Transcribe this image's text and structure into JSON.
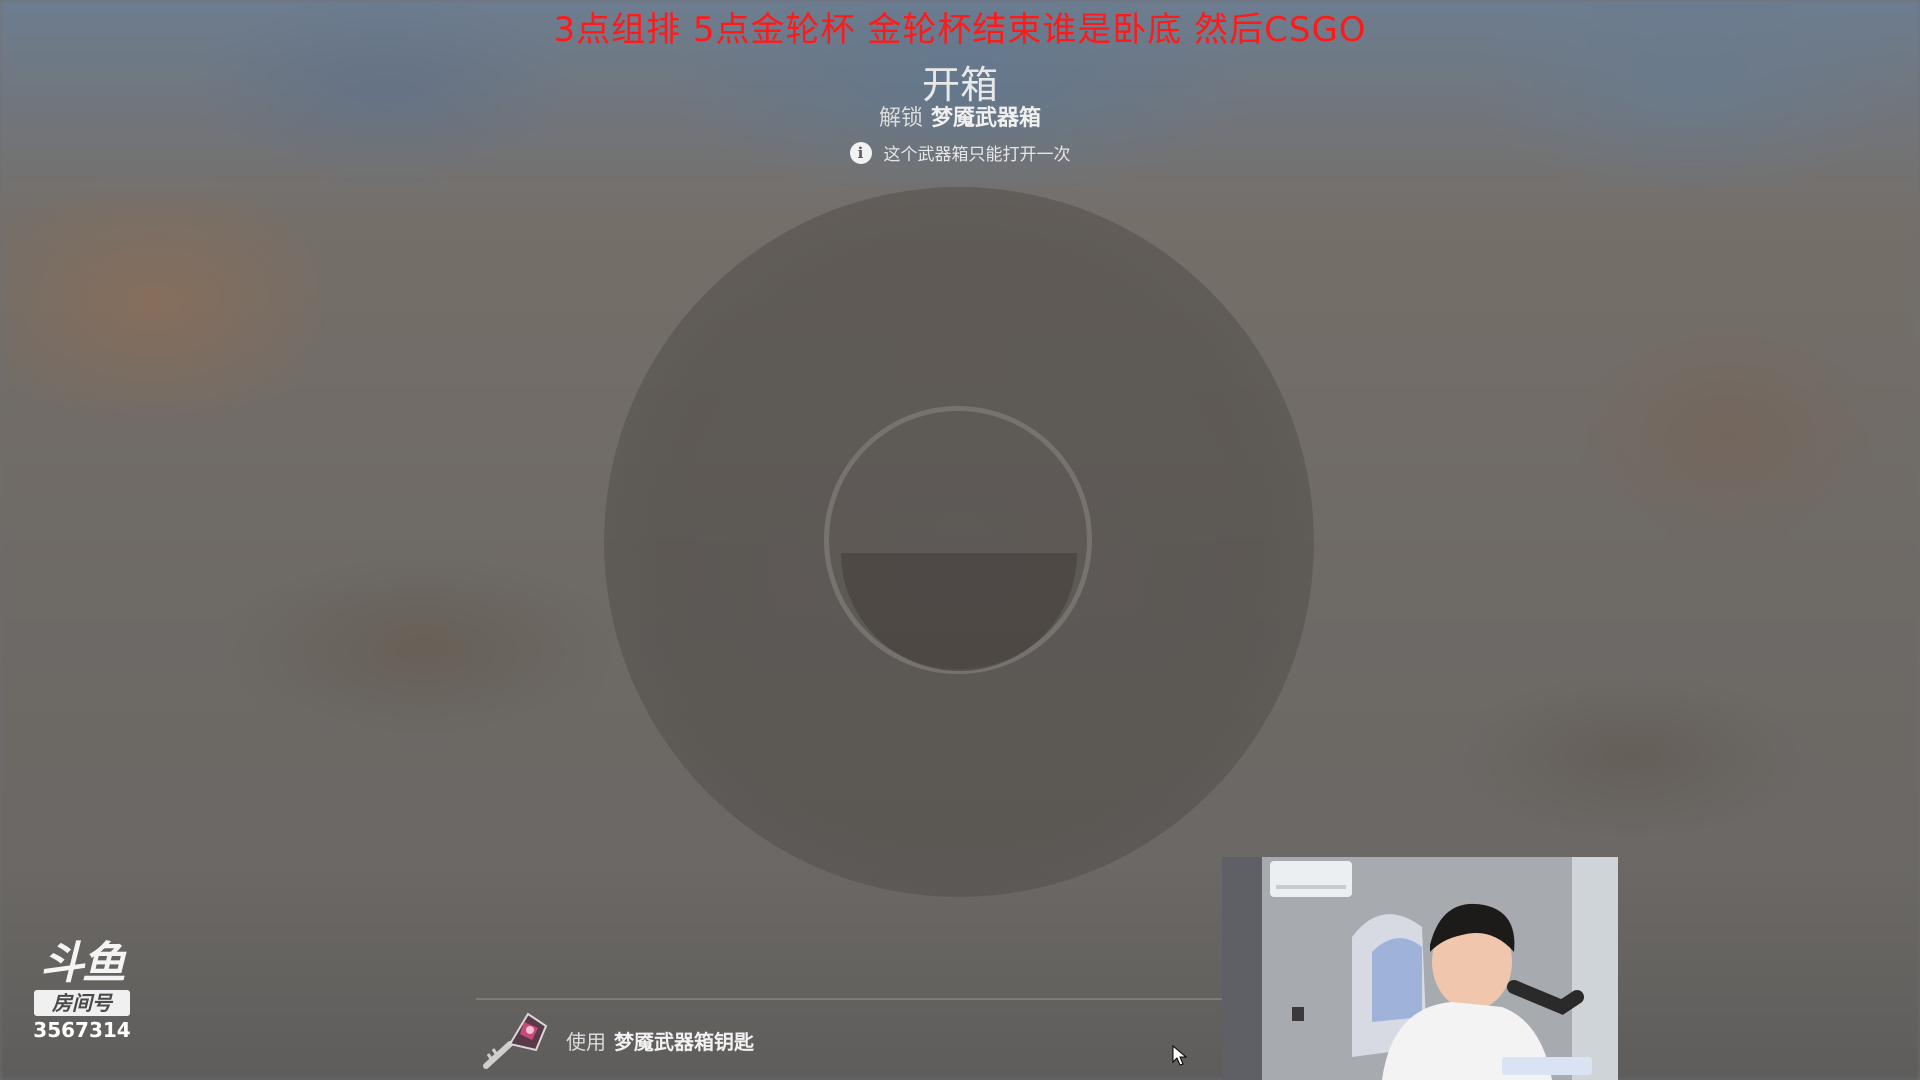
{
  "stream_overlay": {
    "headline": "3点组排 5点金轮杯  金轮杯结束谁是卧底 然后CSGO"
  },
  "case_opening": {
    "title": "开箱",
    "unlock_prefix": "解锁",
    "case_name": "梦魇武器箱",
    "notice": "这个武器箱只能打开一次",
    "use_prefix": "使用",
    "key_name": "梦魇武器箱钥匙"
  },
  "watermark": {
    "brand": "斗鱼",
    "room_label": "房间号",
    "room_id": "3567314"
  },
  "icons": {
    "info": "info-icon",
    "key": "key-icon",
    "cursor": "cursor-icon"
  },
  "colors": {
    "headline": "#ff1a1a"
  }
}
